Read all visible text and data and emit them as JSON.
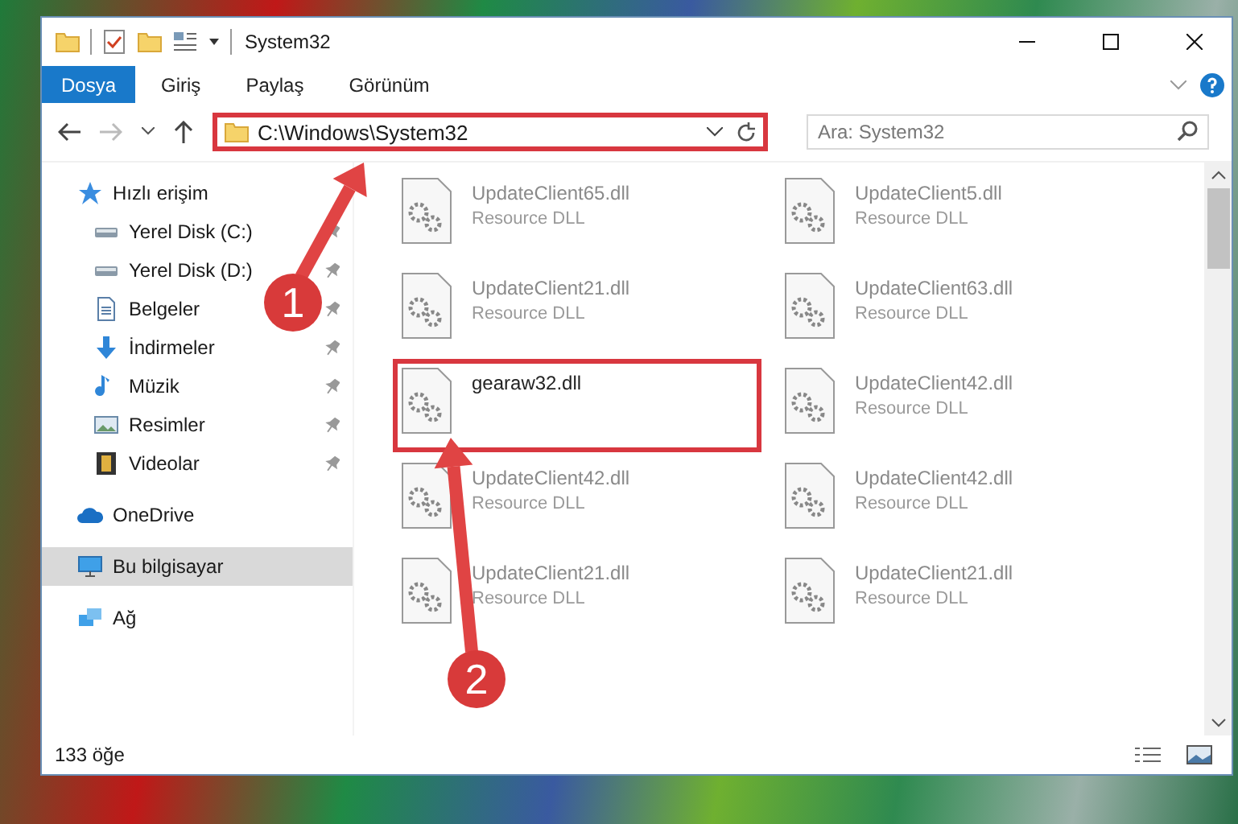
{
  "window": {
    "title": "System32"
  },
  "ribbon_tabs": [
    {
      "label": "Dosya",
      "selected": true
    },
    {
      "label": "Giriş",
      "selected": false
    },
    {
      "label": "Paylaş",
      "selected": false
    },
    {
      "label": "Görünüm",
      "selected": false
    }
  ],
  "address_bar": {
    "path": "C:\\Windows\\System32",
    "highlighted": true
  },
  "search": {
    "placeholder": "Ara: System32"
  },
  "sidebar": {
    "items": [
      {
        "label": "Hızlı erişim",
        "kind": "star",
        "selected": false,
        "children": [
          {
            "label": "Yerel Disk (C:)",
            "kind": "drive",
            "pinned": true,
            "selected": false
          },
          {
            "label": "Yerel Disk (D:)",
            "kind": "drive",
            "pinned": true,
            "selected": false
          },
          {
            "label": "Belgeler",
            "kind": "document",
            "pinned": true,
            "selected": false
          },
          {
            "label": "İndirmeler",
            "kind": "download",
            "pinned": true,
            "selected": false
          },
          {
            "label": "Müzik",
            "kind": "music",
            "pinned": true,
            "selected": false
          },
          {
            "label": "Resimler",
            "kind": "picture",
            "pinned": true,
            "selected": false
          },
          {
            "label": "Videolar",
            "kind": "video",
            "pinned": true,
            "selected": false
          }
        ]
      },
      {
        "label": "OneDrive",
        "kind": "cloud",
        "selected": false
      },
      {
        "label": "Bu bilgisayar",
        "kind": "computer",
        "selected": true
      },
      {
        "label": "Ağ",
        "kind": "network",
        "selected": false
      }
    ]
  },
  "files": [
    {
      "name": "UpdateClient65.dll",
      "type": "Resource DLL",
      "blurred": true,
      "highlighted": false
    },
    {
      "name": "UpdateClient5.dll",
      "type": "Resource DLL",
      "blurred": true,
      "highlighted": false
    },
    {
      "name": "UpdateClient21.dll",
      "type": "Resource DLL",
      "blurred": true,
      "highlighted": false
    },
    {
      "name": "UpdateClient63.dll",
      "type": "Resource DLL",
      "blurred": true,
      "highlighted": false
    },
    {
      "name": "gearaw32.dll",
      "blurred": false,
      "highlighted": true
    },
    {
      "name": "UpdateClient42.dll",
      "type": "Resource DLL",
      "blurred": true,
      "highlighted": false
    },
    {
      "name": "UpdateClient42.dll",
      "type": "Resource DLL",
      "blurred": true,
      "highlighted": false
    },
    {
      "name": "UpdateClient42.dll",
      "type": "Resource DLL",
      "blurred": true,
      "highlighted": false
    },
    {
      "name": "UpdateClient21.dll",
      "type": "Resource DLL",
      "blurred": true,
      "highlighted": false
    },
    {
      "name": "UpdateClient21.dll",
      "type": "Resource DLL",
      "blurred": true,
      "highlighted": false
    }
  ],
  "status_bar": {
    "count": "133 öğe"
  },
  "annotations": [
    {
      "label": "1"
    },
    {
      "label": "2"
    }
  ]
}
